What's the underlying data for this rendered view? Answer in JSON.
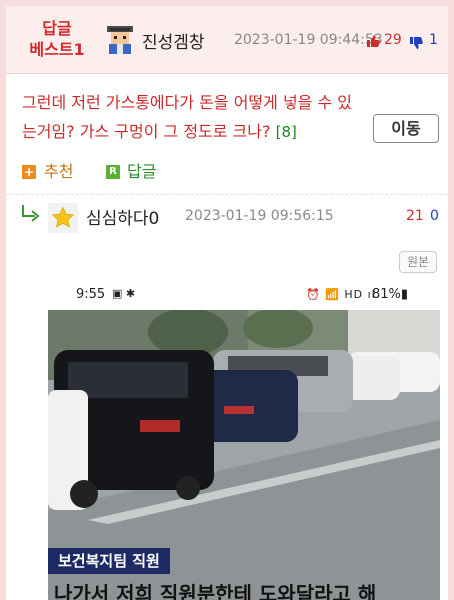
{
  "best_comment": {
    "badge": "답글\n베스트1",
    "badge_line1": "답글",
    "badge_line2": "베스트1",
    "author": "진성겜창",
    "date": "2023-01-19 09:44:53",
    "upvotes": "29",
    "downvotes": "1",
    "body_line1": "그런데 저런 가스통에다가 돈을 어떻게 넣을 수 있",
    "body_line2": "는거임? 가스 구멍이 그 정도로 크나?",
    "reply_count": "[8]",
    "move_button": "이동",
    "recommend_label": "추천",
    "reply_label": "답글",
    "recommend_icon": "+",
    "reply_icon": "R"
  },
  "reply": {
    "author": "심심하다0",
    "date": "2023-01-19 09:56:15",
    "upvotes": "21",
    "downvotes": "0",
    "original_button": "원본"
  },
  "embedded_screenshot": {
    "time": "9:55",
    "left_status_icons": "▣ ✱",
    "right_status_icons": "⏰ 📶 HD ıl",
    "battery": "81%▮",
    "caption_tag": "보건복지팀 직원",
    "caption_text": "나가서 저희 직원분한테 도와달라고 해"
  },
  "colors": {
    "accent_red": "#d12c2c",
    "accent_blue": "#1f3fbf",
    "best_bg": "#fdeeee",
    "recommend_orange": "#f08c1e",
    "reply_green": "#5ab132"
  }
}
